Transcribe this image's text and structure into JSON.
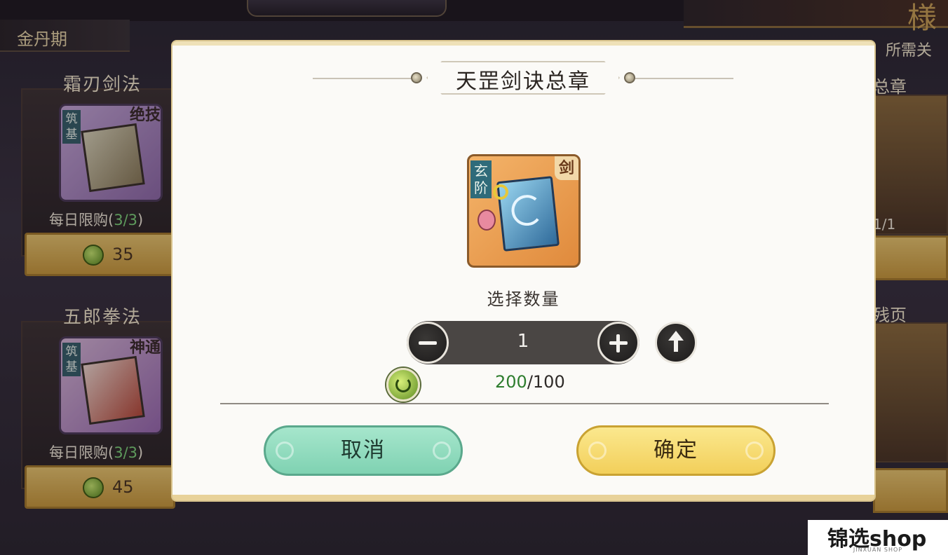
{
  "background": {
    "realm": "金丹期",
    "right_header": "所需关",
    "right_items": [
      "总章",
      "残页"
    ],
    "right_count": "1/1",
    "cards": [
      {
        "name": "霜刃剑法",
        "grade": "筑基",
        "tag": "绝技",
        "limit_prefix": "每日限购",
        "limit_count": "3/3",
        "price": "35"
      },
      {
        "name": "五郎拳法",
        "grade": "筑基",
        "tag": "神通",
        "limit_prefix": "每日限购",
        "limit_count": "3/3",
        "price": "45"
      }
    ],
    "banner_deco": "様"
  },
  "dialog": {
    "title": "天罡剑诀总章",
    "item": {
      "grade": "玄阶",
      "tag": "剑",
      "icon": "sword-manual-book-icon"
    },
    "quantity_label": "选择数量",
    "quantity": "1",
    "cost": {
      "have": "200",
      "separator": "/",
      "need": "100",
      "icon": "spirit-stone-coin-icon"
    },
    "cancel_label": "取消",
    "confirm_label": "确定"
  },
  "watermark": {
    "main": "锦选shop",
    "sub": "JINXUAN SHOP"
  },
  "colors": {
    "cancel_button": "#8fdcc0",
    "confirm_button": "#f6dc70",
    "have_amount": "#2e7d2e",
    "dialog_bg": "#fbfaf7"
  }
}
